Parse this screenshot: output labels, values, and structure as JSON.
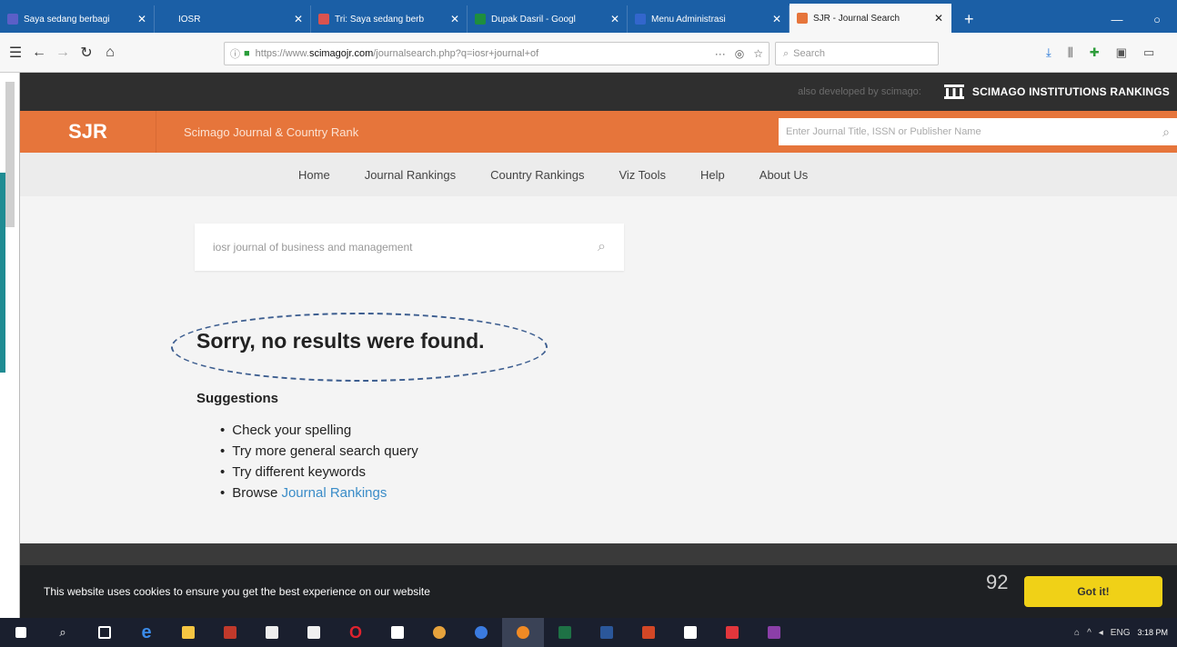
{
  "browser": {
    "tabs": [
      {
        "title": "Saya sedang berbagi",
        "icon": "teams-icon",
        "color": "#5b5fc7",
        "active": false
      },
      {
        "title": "IOSR",
        "icon": "page-icon",
        "color": "#1b5fa6",
        "active": false
      },
      {
        "title": "Tri: Saya sedang berb",
        "icon": "mail-icon",
        "color": "#d9534f",
        "active": false
      },
      {
        "title": "Dupak Dasril - Googl",
        "icon": "sheets-icon",
        "color": "#1e8e3e",
        "active": false
      },
      {
        "title": "Menu Administrasi",
        "icon": "site-icon",
        "color": "#3366cc",
        "active": false
      },
      {
        "title": "SJR - Journal Search",
        "icon": "sjr-icon",
        "color": "#e6753b",
        "active": true
      }
    ],
    "url_prefix": "https://www.",
    "url_domain": "scimagojr.com",
    "url_path": "/journalsearch.php?q=iosr+journal+of",
    "search_placeholder": "Search"
  },
  "site": {
    "also_developed": "also developed by scimago:",
    "institutions": "SCIMAGO INSTITUTIONS RANKINGS",
    "logo": "SJR",
    "title": "Scimago Journal & Country Rank",
    "top_search_placeholder": "Enter Journal Title, ISSN or Publisher Name",
    "menu": [
      "Home",
      "Journal Rankings",
      "Country Rankings",
      "Viz Tools",
      "Help",
      "About Us"
    ]
  },
  "main": {
    "query": "iosr journal of business and management",
    "no_results": "Sorry, no results were found.",
    "suggestions_title": "Suggestions",
    "suggestions": [
      "Check your spelling",
      "Try more general search query",
      "Try different keywords"
    ],
    "browse_prefix": "Browse",
    "browse_link": "Journal Rankings"
  },
  "cookie": {
    "text": "This website uses cookies to ensure you get the best experience on our website",
    "button": "Got it!",
    "page_number": "92"
  },
  "taskbar": {
    "lang": "ENG",
    "time": "3:18 PM"
  }
}
